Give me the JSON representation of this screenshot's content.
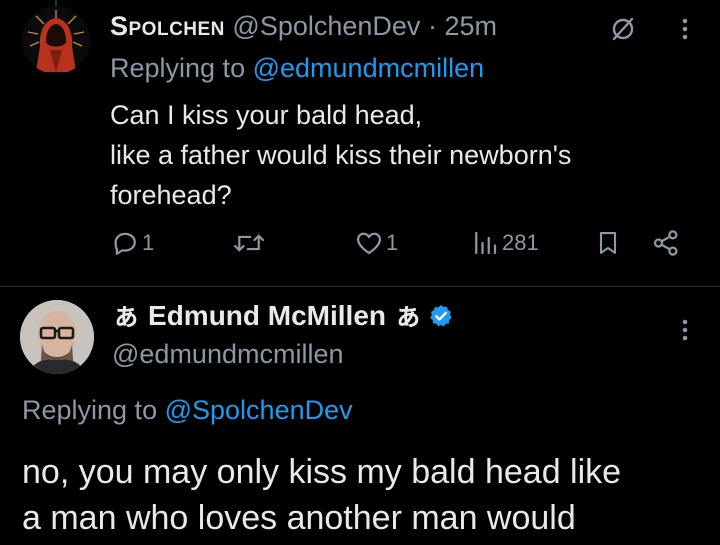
{
  "reply_tweet": {
    "display_name": "Spolchen",
    "handle": "@SpolchenDev",
    "separator": "·",
    "time": "25m",
    "replying_prefix": "Replying to",
    "replying_to": "@edmundmcmillen",
    "text_lines": [
      "Can I kiss your bald head,",
      "like a father would kiss their newborn's",
      "forehead?"
    ],
    "icons": {
      "grok": "slashed-circle-icon",
      "more": "more-vertical-icon"
    },
    "actions": {
      "replies": "1",
      "retweets": "",
      "likes": "1",
      "views": "281"
    }
  },
  "main_tweet": {
    "name_prefix_glyph": "ぁ",
    "display_name": "Edmund McMillen",
    "name_suffix_glyph": "ぁ",
    "verified": true,
    "handle": "@edmundmcmillen",
    "replying_prefix": "Replying to",
    "replying_to": "@SpolchenDev",
    "text_lines": [
      "no, you may only kiss my bald head like",
      "a man who loves another man would"
    ]
  },
  "colors": {
    "background": "#000000",
    "text": "#e7e9ea",
    "secondary": "#8b98a5",
    "accent": "#1d9bf0",
    "divider": "#2f3336"
  }
}
